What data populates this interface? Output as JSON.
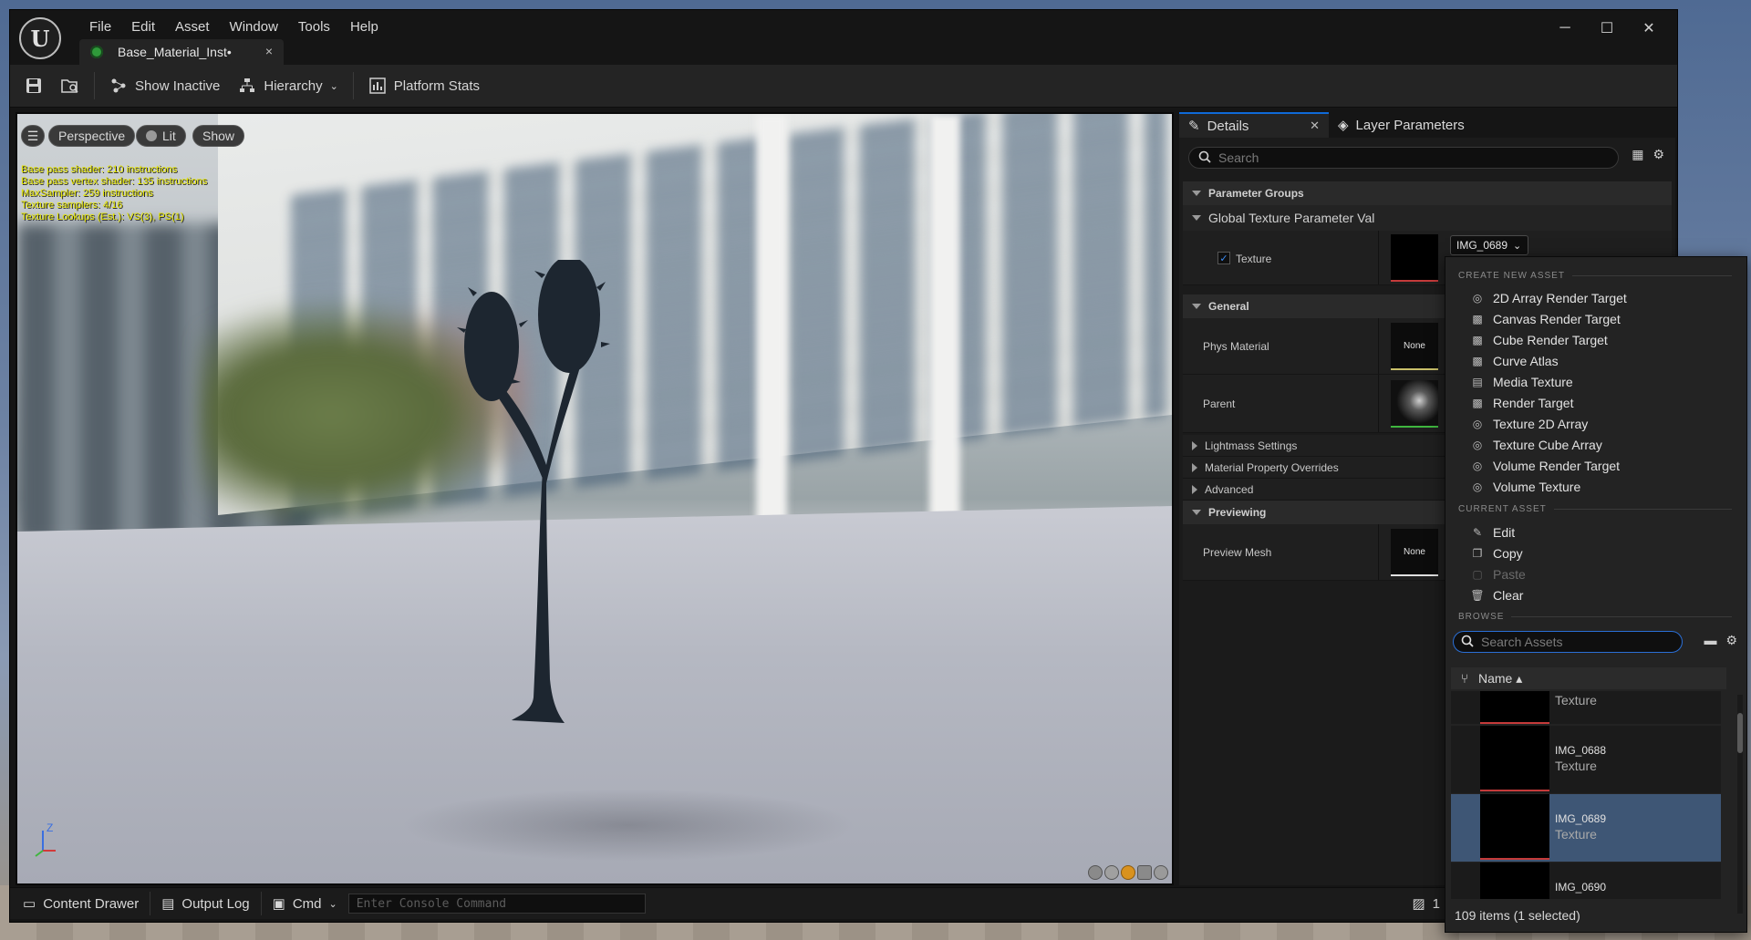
{
  "menu": [
    "File",
    "Edit",
    "Asset",
    "Window",
    "Tools",
    "Help"
  ],
  "document_tab": {
    "label": "Base_Material_Inst•",
    "close": "×"
  },
  "window_controls": {
    "minimize": "─",
    "maximize": "☐",
    "close": "✕"
  },
  "toolbar": {
    "show_inactive": "Show Inactive",
    "hierarchy": "Hierarchy",
    "platform_stats": "Platform Stats"
  },
  "viewport": {
    "perspective": "Perspective",
    "lit": "Lit",
    "show": "Show",
    "stats": [
      "Base pass shader: 210 instructions",
      "Base pass vertex shader: 135 instructions",
      "MaxSampler: 259 instructions",
      "Texture samplers: 4/16",
      "Texture Lookups (Est.): VS(3), PS(1)"
    ],
    "axis_z": "Z"
  },
  "details": {
    "tab_details": "Details",
    "tab_layers": "Layer Parameters",
    "search_placeholder": "Search",
    "parameter_groups": "Parameter Groups",
    "global_texture": "Global Texture Parameter Val",
    "texture_label": "Texture",
    "texture_value": "IMG_0689",
    "general": "General",
    "phys_material": "Phys Material",
    "phys_value": "None",
    "parent": "Parent",
    "lightmass": "Lightmass Settings",
    "overrides": "Material Property Overrides",
    "advanced": "Advanced",
    "previewing": "Previewing",
    "preview_mesh": "Preview Mesh",
    "preview_value": "None"
  },
  "dropdown": {
    "create_header": "CREATE NEW ASSET",
    "create_items": [
      "2D Array Render Target",
      "Canvas Render Target",
      "Cube Render Target",
      "Curve Atlas",
      "Media Texture",
      "Render Target",
      "Texture 2D Array",
      "Texture Cube Array",
      "Volume Render Target",
      "Volume Texture"
    ],
    "current_header": "CURRENT ASSET",
    "edit": "Edit",
    "copy": "Copy",
    "paste": "Paste",
    "clear": "Clear",
    "browse_header": "BROWSE",
    "search_placeholder": "Search Assets",
    "name_column": "Name ▴",
    "assets": [
      {
        "name": "",
        "type": "Texture"
      },
      {
        "name": "IMG_0688",
        "type": "Texture"
      },
      {
        "name": "IMG_0689",
        "type": "Texture"
      },
      {
        "name": "IMG_0690",
        "type": ""
      }
    ],
    "footer": "109 items (1 selected)"
  },
  "statusbar": {
    "content_drawer": "Content Drawer",
    "output_log": "Output Log",
    "cmd": "Cmd",
    "console_placeholder": "Enter Console Command",
    "right_text": "1"
  }
}
